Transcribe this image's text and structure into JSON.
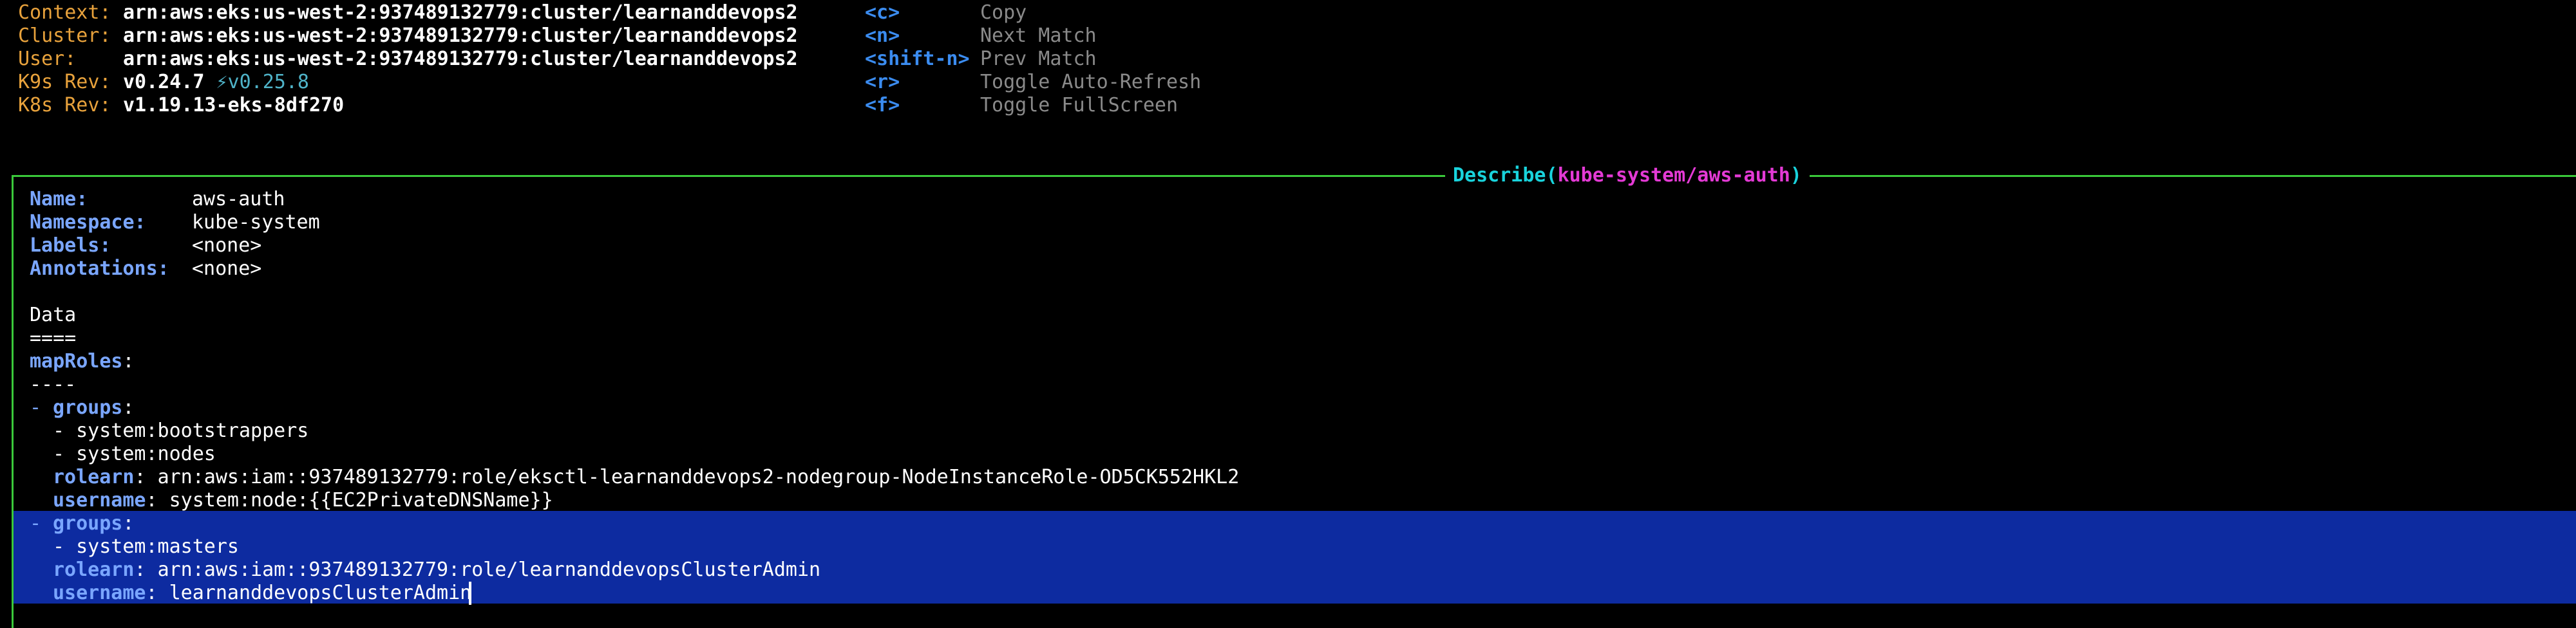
{
  "header": {
    "info": [
      {
        "label": "Context:",
        "value": "arn:aws:eks:us-west-2:937489132779:cluster/learnanddevops2"
      },
      {
        "label": "Cluster:",
        "value": "arn:aws:eks:us-west-2:937489132779:cluster/learnanddevops2"
      },
      {
        "label": "User:",
        "value": "arn:aws:eks:us-west-2:937489132779:cluster/learnanddevops2"
      },
      {
        "label": "K9s Rev:",
        "value": "v0.24.7",
        "extra": "⚡v0.25.8"
      },
      {
        "label": "K8s Rev:",
        "value": "v1.19.13-eks-8df270"
      }
    ],
    "shortcuts": [
      {
        "key": "<c>",
        "desc": "Copy"
      },
      {
        "key": "<n>",
        "desc": "Next Match"
      },
      {
        "key": "<shift-n>",
        "desc": "Prev Match"
      },
      {
        "key": "<r>",
        "desc": "Toggle Auto-Refresh"
      },
      {
        "key": "<f>",
        "desc": "Toggle FullScreen"
      }
    ]
  },
  "panel": {
    "title_prefix": "Describe(",
    "title_target": "kube-system/aws-auth",
    "title_suffix": ")"
  },
  "describe": {
    "fields": [
      {
        "label": "Name:",
        "value": "aws-auth"
      },
      {
        "label": "Namespace:",
        "value": "kube-system"
      },
      {
        "label": "Labels:",
        "value": "<none>"
      },
      {
        "label": "Annotations:",
        "value": "<none>"
      }
    ],
    "data_heading": "Data",
    "data_rule": "====",
    "map_key": "mapRoles",
    "map_colon": ":",
    "map_rule": "----",
    "dash": "-",
    "item_dash": "- ",
    "colon": ":",
    "groups_key": "groups",
    "rolearn_key": "rolearn",
    "username_key": "username",
    "entries": [
      {
        "groups": [
          "system:bootstrappers",
          "system:nodes"
        ],
        "rolearn": "arn:aws:iam::937489132779:role/eksctl-learnanddevops2-nodegroup-NodeInstanceRole-OD5CK552HKL2",
        "username": "system:node:{{EC2PrivateDNSName}}",
        "selected": false
      },
      {
        "groups": [
          "system:masters"
        ],
        "rolearn": "arn:aws:iam::937489132779:role/learnanddevopsClusterAdmin",
        "username": "learnanddevopsClusterAdmin",
        "selected": true
      }
    ]
  },
  "colors": {
    "border": "#3ac93a",
    "selection": "#0d2ba0",
    "header_label": "#e8a23c",
    "shortcut_key": "#3b8cf0",
    "field_key": "#7aa6ff",
    "title_cyan": "#19d3dc",
    "title_magenta": "#e43ad5"
  }
}
